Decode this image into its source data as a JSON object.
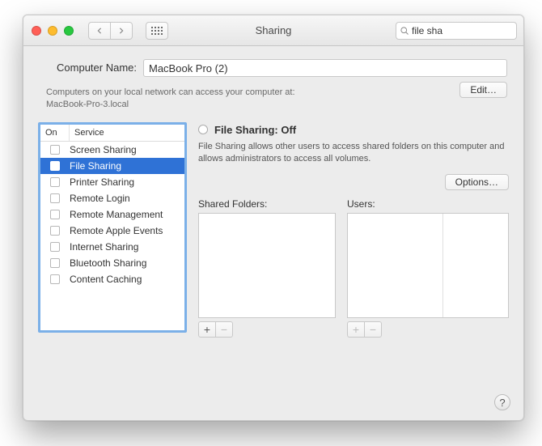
{
  "window": {
    "title": "Sharing"
  },
  "search": {
    "value": "file sha"
  },
  "computer_name": {
    "label": "Computer Name:",
    "value": "MacBook Pro (2)",
    "hint_line1": "Computers on your local network can access your computer at:",
    "hint_line2": "MacBook-Pro-3.local",
    "edit_label": "Edit…"
  },
  "services": {
    "header_on": "On",
    "header_service": "Service",
    "items": [
      {
        "label": "Screen Sharing"
      },
      {
        "label": "File Sharing"
      },
      {
        "label": "Printer Sharing"
      },
      {
        "label": "Remote Login"
      },
      {
        "label": "Remote Management"
      },
      {
        "label": "Remote Apple Events"
      },
      {
        "label": "Internet Sharing"
      },
      {
        "label": "Bluetooth Sharing"
      },
      {
        "label": "Content Caching"
      }
    ]
  },
  "detail": {
    "status_title": "File Sharing: Off",
    "status_desc": "File Sharing allows other users to access shared folders on this computer and allows administrators to access all volumes.",
    "options_label": "Options…",
    "shared_folders_label": "Shared Folders:",
    "users_label": "Users:"
  },
  "help": {
    "label": "?"
  }
}
